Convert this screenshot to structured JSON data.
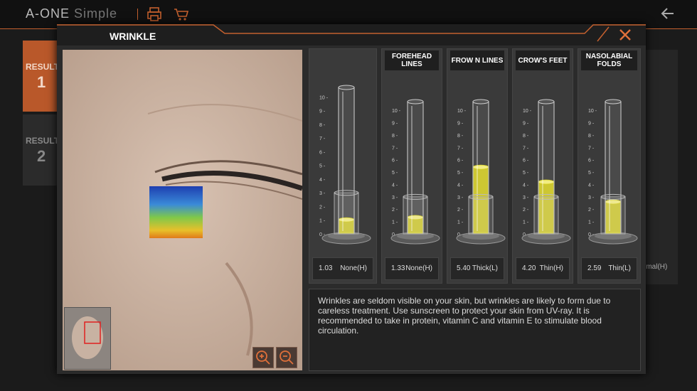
{
  "app": {
    "brand": "A-ONE",
    "brand_suffix": "Simple"
  },
  "results": [
    {
      "label": "RESULT",
      "number": "1",
      "active": true
    },
    {
      "label": "RESULT",
      "number": "2",
      "active": false
    }
  ],
  "background": {
    "peek_label": "rmal(H)"
  },
  "modal": {
    "title": "WRINKLE",
    "gauges": [
      {
        "label": "",
        "value": "1.03",
        "level": "None(H)",
        "fill": 1.03
      },
      {
        "label": "FOREHEAD LINES",
        "value": "1.33",
        "level": "None(H)",
        "fill": 1.33
      },
      {
        "label": "FROW N LINES",
        "value": "5.40",
        "level": "Thick(L)",
        "fill": 5.4
      },
      {
        "label": "CROW'S FEET",
        "value": "4.20",
        "level": "Thin(H)",
        "fill": 4.2
      },
      {
        "label": "NASOLABIAL FOLDS",
        "value": "2.59",
        "level": "Thin(L)",
        "fill": 2.59
      }
    ],
    "scale_ticks": [
      "10",
      "9",
      "8",
      "7",
      "6",
      "5",
      "4",
      "3",
      "2",
      "1",
      "0"
    ],
    "description": "Wrinkles are seldom visible on your skin, but wrinkles are likely to form due to careless treatment. Use sunscreen to protect your skin from UV-ray. It is recommended to take in protein, vitamin C and vitamin E to stimulate blood circulation."
  },
  "colors": {
    "accent": "#c4602e",
    "fill": "#e9e21a"
  }
}
